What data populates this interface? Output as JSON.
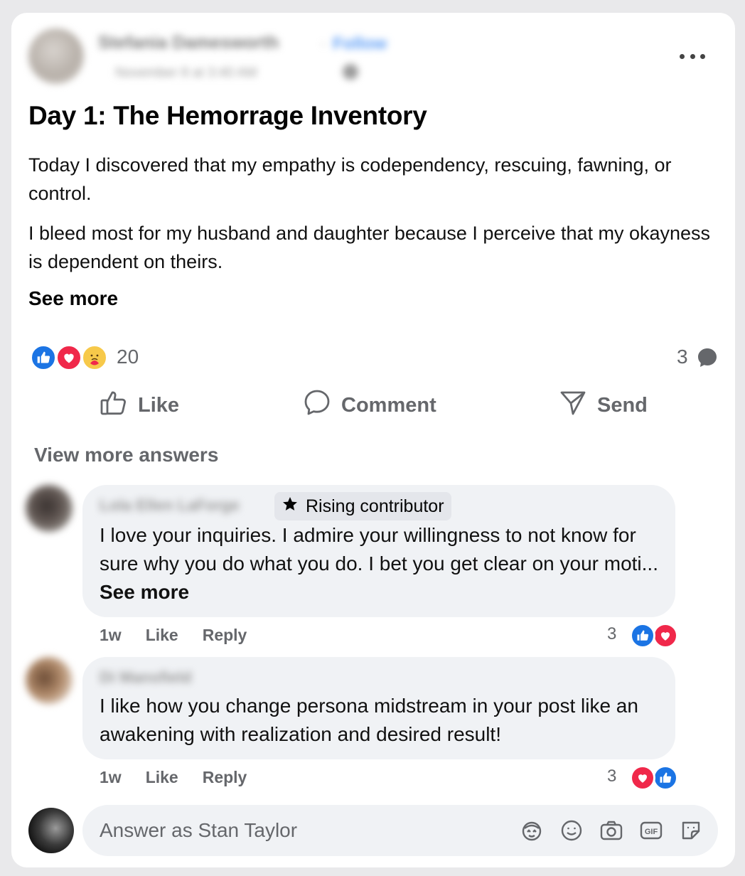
{
  "post": {
    "author_name": "Stefania Damesworth",
    "follow_label": "Follow",
    "date": "November 8 at 3:40 AM",
    "title": "Day 1: The Hemorrage Inventory",
    "paragraphs": [
      "Today I discovered that my empathy is codependency, rescuing, fawning, or control.",
      "I bleed most for my husband and daughter because I perceive that my okayness is dependent on theirs."
    ],
    "see_more_label": "See more",
    "reaction_count": "20",
    "reaction_icons": [
      "like-icon",
      "love-icon",
      "care-icon"
    ],
    "comment_count": "3"
  },
  "actions": {
    "like_label": "Like",
    "comment_label": "Comment",
    "send_label": "Send"
  },
  "comments_section": {
    "view_more_label": "View more answers",
    "comments": [
      {
        "author": "Lola Ellen LaForge",
        "badge": "Rising contributor",
        "text": "I love your inquiries. I admire your willingness to not know for sure why you do what you do. I bet you get clear on your moti...",
        "see_more": "See more",
        "time": "1w",
        "like_label": "Like",
        "reply_label": "Reply",
        "reaction_count": "3",
        "reaction_icons": [
          "like-icon",
          "love-icon"
        ]
      },
      {
        "author": "Di Mansfield",
        "text": "I like how you change persona midstream in your post like an awakening with realization and desired result!",
        "time": "1w",
        "like_label": "Like",
        "reply_label": "Reply",
        "reaction_count": "3",
        "reaction_icons": [
          "love-icon",
          "like-icon"
        ]
      }
    ]
  },
  "composer": {
    "placeholder": "Answer as Stan Taylor",
    "tools": [
      "avatar-sticker-icon",
      "emoji-icon",
      "camera-icon",
      "gif-icon",
      "sticker-icon"
    ]
  },
  "colors": {
    "like_blue": "#1b74e4",
    "love_red": "#f0284a",
    "care_yellow": "#f7c94a",
    "secondary_text": "#65676b",
    "bubble_bg": "#f0f2f5"
  }
}
